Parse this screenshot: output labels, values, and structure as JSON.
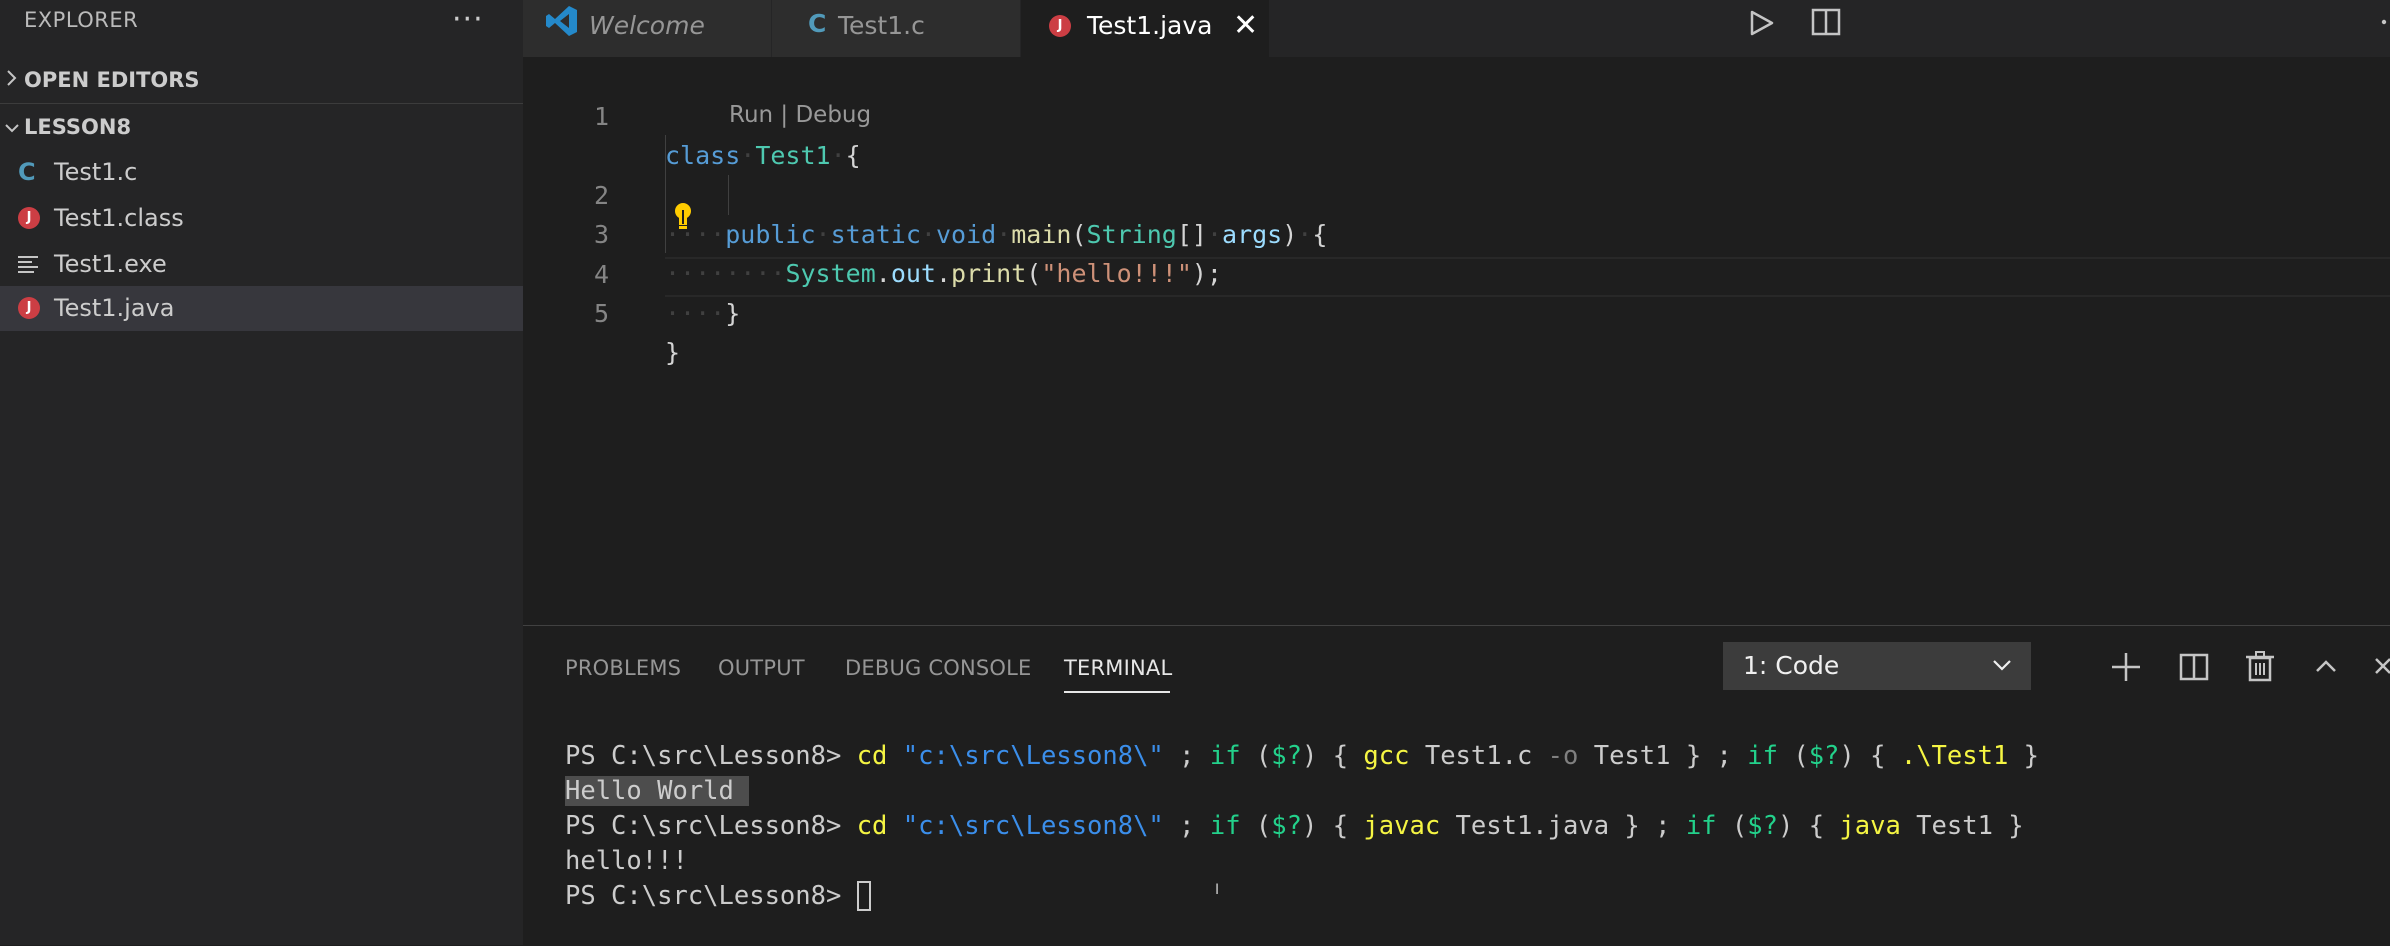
{
  "sidebar": {
    "title": "EXPLORER",
    "more_label": "···",
    "open_editors_label": "OPEN EDITORS",
    "folder_label": "LESSON8",
    "files": [
      {
        "name": "Test1.c",
        "icon": "c-file-icon"
      },
      {
        "name": "Test1.class",
        "icon": "java-file-icon"
      },
      {
        "name": "Test1.exe",
        "icon": "text-file-icon"
      },
      {
        "name": "Test1.java",
        "icon": "java-file-icon",
        "selected": true
      }
    ]
  },
  "tabs": [
    {
      "label": "Welcome",
      "icon": "vscode-logo-icon",
      "active": false
    },
    {
      "label": "Test1.c",
      "icon": "c-file-icon",
      "active": false
    },
    {
      "label": "Test1.java",
      "icon": "java-file-icon",
      "active": true,
      "close": "✕"
    }
  ],
  "editor": {
    "line_numbers": [
      "1",
      "2",
      "3",
      "4",
      "5"
    ],
    "codelens": "Run | Debug",
    "lines": [
      [
        [
          "kw",
          "class"
        ],
        [
          "ws",
          "·"
        ],
        [
          "cls",
          "Test1"
        ],
        [
          "ws",
          "·"
        ],
        [
          "p",
          "{"
        ]
      ],
      [
        [
          "ws",
          "····"
        ],
        [
          "kw",
          "public"
        ],
        [
          "ws",
          "·"
        ],
        [
          "kw",
          "static"
        ],
        [
          "ws",
          "·"
        ],
        [
          "kw",
          "void"
        ],
        [
          "ws",
          "·"
        ],
        [
          "fn",
          "main"
        ],
        [
          "p",
          "("
        ],
        [
          "cls",
          "String"
        ],
        [
          "p",
          "[]"
        ],
        [
          "ws",
          "·"
        ],
        [
          "var",
          "args"
        ],
        [
          "p",
          ")"
        ],
        [
          "ws",
          "·"
        ],
        [
          "p",
          "{"
        ]
      ],
      [
        [
          "ws",
          "····"
        ],
        [
          "ws",
          "····"
        ],
        [
          "cls",
          "System"
        ],
        [
          "p",
          "."
        ],
        [
          "var",
          "out"
        ],
        [
          "p",
          "."
        ],
        [
          "fn",
          "print"
        ],
        [
          "p",
          "("
        ],
        [
          "str",
          "\"hello!!!\""
        ],
        [
          "p",
          ");"
        ]
      ],
      [
        [
          "ws",
          "····"
        ],
        [
          "p",
          "}"
        ]
      ],
      [
        [
          "p",
          "}"
        ]
      ]
    ]
  },
  "panel": {
    "tabs": [
      "PROBLEMS",
      "OUTPUT",
      "DEBUG CONSOLE",
      "TERMINAL"
    ],
    "active_tab": "TERMINAL",
    "terminal_select": "1: Code",
    "terminal_lines": [
      [
        [
          "p",
          "PS C:\\src\\Lesson8> "
        ],
        [
          "cmd",
          "cd"
        ],
        [
          "p",
          " "
        ],
        [
          "str",
          "\"c:\\src\\Lesson8\\\""
        ],
        [
          "p",
          " ; "
        ],
        [
          "kw",
          "if"
        ],
        [
          "p",
          " ("
        ],
        [
          "kw",
          "$?"
        ],
        [
          "p",
          ") { "
        ],
        [
          "cmd",
          "gcc"
        ],
        [
          "p",
          " Test1.c "
        ],
        [
          "dim",
          "-o"
        ],
        [
          "p",
          " Test1 } ; "
        ],
        [
          "kw",
          "if"
        ],
        [
          "p",
          " ("
        ],
        [
          "kw",
          "$?"
        ],
        [
          "p",
          ") { "
        ],
        [
          "cmd",
          ".\\Test1"
        ],
        [
          "p",
          " }"
        ]
      ],
      [
        [
          "hl",
          "Hello World "
        ]
      ],
      [
        [
          "p",
          "PS C:\\src\\Lesson8> "
        ],
        [
          "cmd",
          "cd"
        ],
        [
          "p",
          " "
        ],
        [
          "str",
          "\"c:\\src\\Lesson8\\\""
        ],
        [
          "p",
          " ; "
        ],
        [
          "kw",
          "if"
        ],
        [
          "p",
          " ("
        ],
        [
          "kw",
          "$?"
        ],
        [
          "p",
          ") { "
        ],
        [
          "cmd",
          "javac"
        ],
        [
          "p",
          " Test1.java } ; "
        ],
        [
          "kw",
          "if"
        ],
        [
          "p",
          " ("
        ],
        [
          "kw",
          "$?"
        ],
        [
          "p",
          ") { "
        ],
        [
          "cmd",
          "java"
        ],
        [
          "p",
          " Test1 }"
        ]
      ],
      [
        [
          "p",
          "hello!!!"
        ]
      ],
      [
        [
          "p",
          "PS C:\\src\\Lesson8> "
        ],
        [
          "cursor",
          ""
        ]
      ]
    ]
  },
  "colors": {
    "accent_java": "#cc3e44",
    "accent_c": "#519aba",
    "vscode_blue": "#007acc"
  }
}
